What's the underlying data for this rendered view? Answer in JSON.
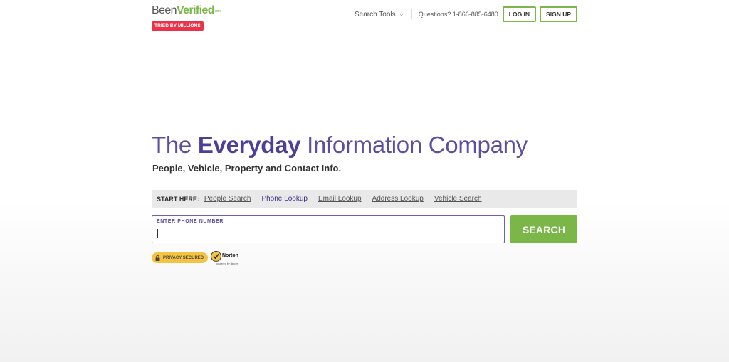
{
  "header": {
    "logo": {
      "been": "Been",
      "verified": "Verified",
      "com": ".com",
      "badge": "TRIED BY MILLIONS"
    },
    "nav": {
      "search_tools": "Search Tools",
      "questions": "Questions? 1-866-885-6480",
      "login": "LOG IN",
      "signup": "SIGN UP"
    }
  },
  "hero": {
    "title_pre": "The ",
    "title_bold": "Everyday",
    "title_post": " Information Company",
    "subtitle": "People, Vehicle, Property and Contact Info."
  },
  "search": {
    "start_label": "START HERE:",
    "tabs": [
      {
        "label": "People Search",
        "active": false
      },
      {
        "label": "Phone Lookup",
        "active": true
      },
      {
        "label": "Email Lookup",
        "active": false
      },
      {
        "label": "Address Lookup",
        "active": false
      },
      {
        "label": "Vehicle Search",
        "active": false
      }
    ],
    "input_label": "ENTER PHONE NUMBER",
    "input_value": "",
    "button": "SEARCH"
  },
  "badges": {
    "privacy": "PRIVACY SECURED",
    "norton": "Norton",
    "norton_sub": "powered by digicert"
  },
  "colors": {
    "brand_green": "#7ab648",
    "brand_purple": "#5a4fa0",
    "badge_red": "#e8334a",
    "privacy_yellow": "#f5c342"
  },
  "icons": {
    "chevron": "chevron-down-icon",
    "lock": "lock-icon",
    "norton_check": "checkmark-icon"
  }
}
